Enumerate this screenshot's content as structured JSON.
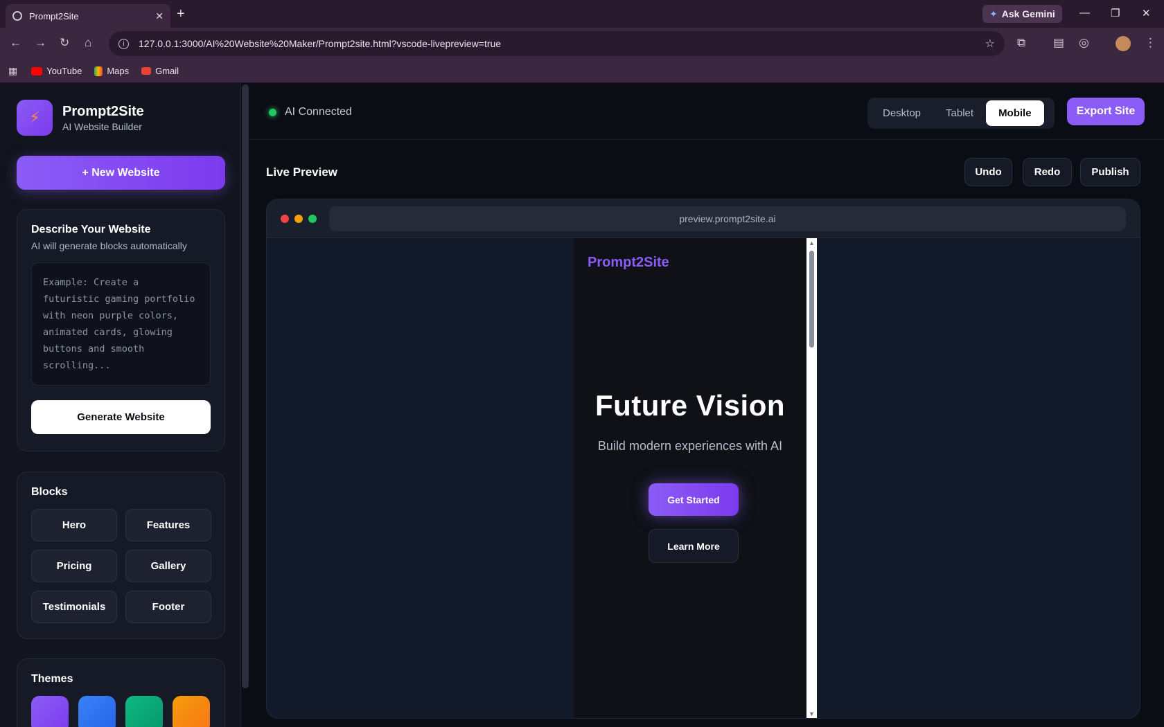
{
  "browser": {
    "tab_title": "Prompt2Site",
    "new_tab": "+",
    "gemini_label": "Ask Gemini",
    "url": "127.0.0.1:3000/AI%20Website%20Maker/Prompt2site.html?vscode-livepreview=true",
    "bookmarks": [
      "YouTube",
      "Maps",
      "Gmail"
    ]
  },
  "sidebar": {
    "brand_name": "Prompt2Site",
    "brand_sub": "AI Website Builder",
    "new_website": "+  New Website",
    "describe": {
      "title": "Describe Your Website",
      "subtitle": "AI will generate blocks automatically",
      "placeholder": "Example: Create a futuristic gaming portfolio with neon purple colors, animated cards, glowing buttons and smooth scrolling...",
      "generate": "Generate Website"
    },
    "blocks": {
      "title": "Blocks",
      "items": [
        "Hero",
        "Features",
        "Pricing",
        "Gallery",
        "Testimonials",
        "Footer"
      ]
    },
    "themes": {
      "title": "Themes",
      "swatches": [
        "#8b5cf6",
        "#3b82f6",
        "#10b981",
        "#f59e0b"
      ]
    }
  },
  "header": {
    "status": "AI Connected",
    "devices": [
      "Desktop",
      "Tablet",
      "Mobile"
    ],
    "active_device": "Mobile",
    "export": "Export Site"
  },
  "preview": {
    "title": "Live Preview",
    "actions": [
      "Undo",
      "Redo",
      "Publish"
    ],
    "url": "preview.prompt2site.ai",
    "site": {
      "brand": "Prompt2Site",
      "hero": "Future Vision",
      "subtitle": "Build modern experiences with AI",
      "primary": "Get Started",
      "secondary": "Learn More"
    }
  },
  "colors": {
    "accent": "#8b5cf6",
    "status_ok": "#22c55e"
  }
}
